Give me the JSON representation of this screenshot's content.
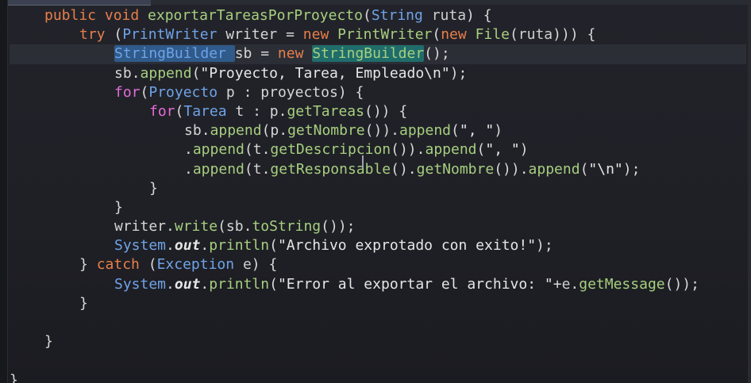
{
  "editor": {
    "language": "Java",
    "lines": [
      {
        "indent": 1,
        "tokens": [
          {
            "t": "public ",
            "c": "kw"
          },
          {
            "t": "void ",
            "c": "kw"
          },
          {
            "t": "exportarTareasPorProyecto",
            "c": "fn"
          },
          {
            "t": "(",
            "c": "punct"
          },
          {
            "t": "String ",
            "c": "type"
          },
          {
            "t": "ruta",
            "c": "param"
          },
          {
            "t": ") {",
            "c": "punct"
          }
        ]
      },
      {
        "indent": 2,
        "tokens": [
          {
            "t": "try ",
            "c": "kw"
          },
          {
            "t": "(",
            "c": "punct"
          },
          {
            "t": "PrintWriter ",
            "c": "type"
          },
          {
            "t": "writer ",
            "c": "var"
          },
          {
            "t": "= ",
            "c": "punct"
          },
          {
            "t": "new ",
            "c": "kw"
          },
          {
            "t": "PrintWriter",
            "c": "fn"
          },
          {
            "t": "(",
            "c": "punct"
          },
          {
            "t": "new ",
            "c": "kw"
          },
          {
            "t": "File",
            "c": "fn"
          },
          {
            "t": "(",
            "c": "punct"
          },
          {
            "t": "ruta",
            "c": "param"
          },
          {
            "t": "))) {",
            "c": "punct"
          }
        ]
      },
      {
        "indent": 3,
        "current": true,
        "tokens": [
          {
            "t": "StringBuilder ",
            "c": "type sel"
          },
          {
            "t": "sb ",
            "c": "var"
          },
          {
            "t": "= ",
            "c": "punct"
          },
          {
            "t": "new ",
            "c": "kw"
          },
          {
            "t": "StringBuilder",
            "c": "fn sel2"
          },
          {
            "t": "();",
            "c": "punct"
          }
        ]
      },
      {
        "indent": 3,
        "tokens": [
          {
            "t": "sb",
            "c": "var"
          },
          {
            "t": ".",
            "c": "punct"
          },
          {
            "t": "append",
            "c": "fn"
          },
          {
            "t": "(",
            "c": "punct"
          },
          {
            "t": "\"Proyecto, Tarea, Empleado\\n\"",
            "c": "str"
          },
          {
            "t": ");",
            "c": "punct"
          }
        ]
      },
      {
        "indent": 3,
        "tokens": [
          {
            "t": "for",
            "c": "ctl"
          },
          {
            "t": "(",
            "c": "punct"
          },
          {
            "t": "Proyecto ",
            "c": "type"
          },
          {
            "t": "p ",
            "c": "var"
          },
          {
            "t": ": ",
            "c": "punct"
          },
          {
            "t": "proyectos",
            "c": "var"
          },
          {
            "t": ") {",
            "c": "punct"
          }
        ]
      },
      {
        "indent": 4,
        "tokens": [
          {
            "t": "for",
            "c": "ctl"
          },
          {
            "t": "(",
            "c": "punct"
          },
          {
            "t": "Tarea ",
            "c": "type"
          },
          {
            "t": "t ",
            "c": "var"
          },
          {
            "t": ": ",
            "c": "punct"
          },
          {
            "t": "p",
            "c": "var"
          },
          {
            "t": ".",
            "c": "punct"
          },
          {
            "t": "getTareas",
            "c": "fn"
          },
          {
            "t": "()) {",
            "c": "punct"
          }
        ]
      },
      {
        "indent": 5,
        "tokens": [
          {
            "t": "sb",
            "c": "var"
          },
          {
            "t": ".",
            "c": "punct"
          },
          {
            "t": "append",
            "c": "fn"
          },
          {
            "t": "(",
            "c": "punct"
          },
          {
            "t": "p",
            "c": "var"
          },
          {
            "t": ".",
            "c": "punct"
          },
          {
            "t": "getNombre",
            "c": "fn"
          },
          {
            "t": "()).",
            "c": "punct"
          },
          {
            "t": "append",
            "c": "fn"
          },
          {
            "t": "(",
            "c": "punct"
          },
          {
            "t": "\", \"",
            "c": "str"
          },
          {
            "t": ")",
            "c": "punct"
          }
        ]
      },
      {
        "indent": 5,
        "tokens": [
          {
            "t": ".",
            "c": "punct"
          },
          {
            "t": "append",
            "c": "fn"
          },
          {
            "t": "(",
            "c": "punct"
          },
          {
            "t": "t",
            "c": "var"
          },
          {
            "t": ".",
            "c": "punct"
          },
          {
            "t": "getDescripcion",
            "c": "fn"
          },
          {
            "t": "()).",
            "c": "punct"
          },
          {
            "t": "append",
            "c": "fn"
          },
          {
            "t": "(",
            "c": "punct"
          },
          {
            "t": "\", \"",
            "c": "str"
          },
          {
            "t": ")",
            "c": "punct"
          }
        ]
      },
      {
        "indent": 5,
        "tokens": [
          {
            "t": ".",
            "c": "punct"
          },
          {
            "t": "append",
            "c": "fn"
          },
          {
            "t": "(",
            "c": "punct"
          },
          {
            "t": "t",
            "c": "var"
          },
          {
            "t": ".",
            "c": "punct"
          },
          {
            "t": "getResponsable",
            "c": "fn"
          },
          {
            "t": "().",
            "c": "punct"
          },
          {
            "t": "getNombre",
            "c": "fn"
          },
          {
            "t": "()).",
            "c": "punct"
          },
          {
            "t": "append",
            "c": "fn"
          },
          {
            "t": "(",
            "c": "punct"
          },
          {
            "t": "\"\\n\"",
            "c": "str"
          },
          {
            "t": ");",
            "c": "punct"
          }
        ]
      },
      {
        "indent": 4,
        "tokens": [
          {
            "t": "}",
            "c": "punct"
          }
        ]
      },
      {
        "indent": 3,
        "tokens": [
          {
            "t": "}",
            "c": "punct"
          }
        ]
      },
      {
        "indent": 3,
        "tokens": [
          {
            "t": "writer",
            "c": "var"
          },
          {
            "t": ".",
            "c": "punct"
          },
          {
            "t": "write",
            "c": "fn"
          },
          {
            "t": "(",
            "c": "punct"
          },
          {
            "t": "sb",
            "c": "var"
          },
          {
            "t": ".",
            "c": "punct"
          },
          {
            "t": "toString",
            "c": "fn"
          },
          {
            "t": "());",
            "c": "punct"
          }
        ]
      },
      {
        "indent": 3,
        "tokens": [
          {
            "t": "System",
            "c": "type"
          },
          {
            "t": ".",
            "c": "punct"
          },
          {
            "t": "out",
            "c": "field"
          },
          {
            "t": ".",
            "c": "punct"
          },
          {
            "t": "println",
            "c": "fn"
          },
          {
            "t": "(",
            "c": "punct"
          },
          {
            "t": "\"Archivo exprotado con exito!\"",
            "c": "str"
          },
          {
            "t": ");",
            "c": "punct"
          }
        ]
      },
      {
        "indent": 2,
        "tokens": [
          {
            "t": "} ",
            "c": "punct"
          },
          {
            "t": "catch ",
            "c": "kw"
          },
          {
            "t": "(",
            "c": "punct"
          },
          {
            "t": "Exception ",
            "c": "type"
          },
          {
            "t": "e",
            "c": "param"
          },
          {
            "t": ") {",
            "c": "punct"
          }
        ]
      },
      {
        "indent": 3,
        "tokens": [
          {
            "t": "System",
            "c": "type"
          },
          {
            "t": ".",
            "c": "punct"
          },
          {
            "t": "out",
            "c": "field"
          },
          {
            "t": ".",
            "c": "punct"
          },
          {
            "t": "println",
            "c": "fn"
          },
          {
            "t": "(",
            "c": "punct"
          },
          {
            "t": "\"Error al exportar el archivo: \"",
            "c": "str"
          },
          {
            "t": "+",
            "c": "punct"
          },
          {
            "t": "e",
            "c": "param"
          },
          {
            "t": ".",
            "c": "punct"
          },
          {
            "t": "getMessage",
            "c": "fn"
          },
          {
            "t": "());",
            "c": "punct"
          }
        ]
      },
      {
        "indent": 2,
        "tokens": [
          {
            "t": "}",
            "c": "punct"
          }
        ]
      },
      {
        "indent": 0,
        "tokens": []
      },
      {
        "indent": 1,
        "tokens": [
          {
            "t": "}",
            "c": "punct"
          }
        ]
      },
      {
        "indent": 0,
        "tokens": []
      },
      {
        "indent": 0,
        "tokens": [
          {
            "t": "}",
            "c": "punct"
          }
        ]
      }
    ]
  },
  "colors": {
    "background": "#1f2026",
    "keyword": "#e87f4a",
    "control": "#e26cd6",
    "type": "#6fa3e8",
    "method": "#a7cf7f",
    "selection": "#2f5a8a",
    "match_highlight": "#1f6d6b"
  }
}
